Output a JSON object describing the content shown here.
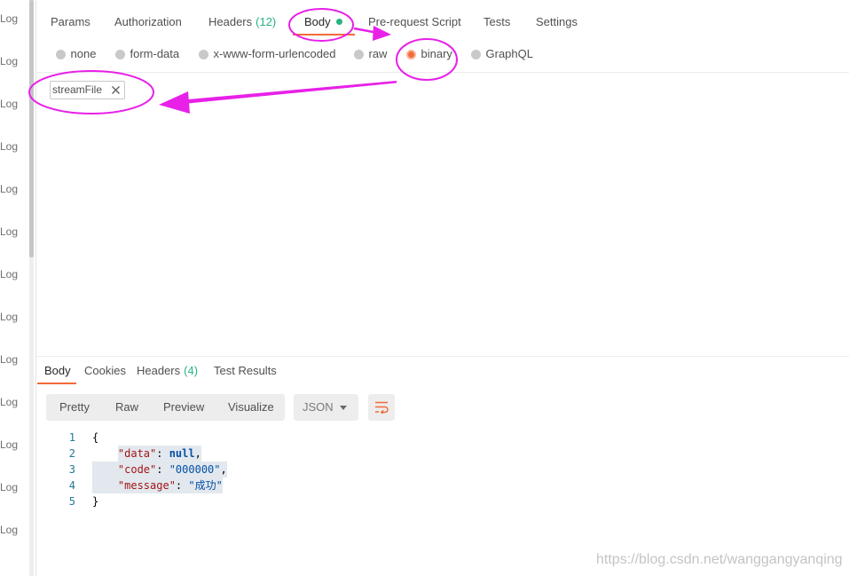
{
  "history": {
    "items": [
      {
        "label": "Log"
      },
      {
        "label": "Log"
      },
      {
        "label": "Log"
      },
      {
        "label": "Log"
      },
      {
        "label": "Log"
      },
      {
        "label": "Log"
      },
      {
        "label": "Log"
      },
      {
        "label": "Log"
      },
      {
        "label": "Log"
      },
      {
        "label": "Log"
      },
      {
        "label": "Log"
      },
      {
        "label": "Log"
      },
      {
        "label": "Log"
      }
    ]
  },
  "request": {
    "tabs": [
      {
        "label": "Params",
        "active": false
      },
      {
        "label": "Authorization",
        "active": false
      },
      {
        "label": "Headers",
        "count": "(12)",
        "active": false
      },
      {
        "label": "Body",
        "active": true
      },
      {
        "label": "Pre-request Script",
        "active": false
      },
      {
        "label": "Tests",
        "active": false
      },
      {
        "label": "Settings",
        "active": false
      }
    ],
    "body_modes": [
      {
        "label": "none",
        "selected": false
      },
      {
        "label": "form-data",
        "selected": false
      },
      {
        "label": "x-www-form-urlencoded",
        "selected": false
      },
      {
        "label": "raw",
        "selected": false
      },
      {
        "label": "binary",
        "selected": true
      },
      {
        "label": "GraphQL",
        "selected": false
      }
    ],
    "file": {
      "name": "streamFile"
    }
  },
  "response": {
    "tabs": [
      {
        "label": "Body",
        "active": true
      },
      {
        "label": "Cookies",
        "active": false
      },
      {
        "label": "Headers",
        "count": "(4)",
        "active": false
      },
      {
        "label": "Test Results",
        "active": false
      }
    ],
    "view_modes": [
      {
        "label": "Pretty"
      },
      {
        "label": "Raw"
      },
      {
        "label": "Preview"
      },
      {
        "label": "Visualize"
      }
    ],
    "format": {
      "label": "JSON"
    },
    "code": {
      "lines": [
        {
          "num": "1",
          "text": "{"
        },
        {
          "num": "2",
          "key": "\"data\"",
          "sep": ": ",
          "value": "null",
          "end": ","
        },
        {
          "num": "3",
          "key": "\"code\"",
          "sep": ": ",
          "value": "\"000000\"",
          "end": ","
        },
        {
          "num": "4",
          "key": "\"message\"",
          "sep": ": ",
          "value": "\"成功\""
        },
        {
          "num": "5",
          "text": "}"
        }
      ]
    }
  },
  "watermark": {
    "text": "https://blog.csdn.net/wanggangyanqing"
  },
  "icons": {
    "body_status": "status-dot-icon",
    "file_remove": "close-icon",
    "format_dropdown": "chevron-down-icon",
    "wrap_lines": "wrap-lines-icon",
    "radio": "radio-icon"
  },
  "colors": {
    "accent": "#f26b3a",
    "count": "#26b47f",
    "status_dot": "#26b47f",
    "annotation": "#e820e8",
    "json_key": "#a31515",
    "json_value": "#0451a5",
    "line_number": "#237893"
  }
}
